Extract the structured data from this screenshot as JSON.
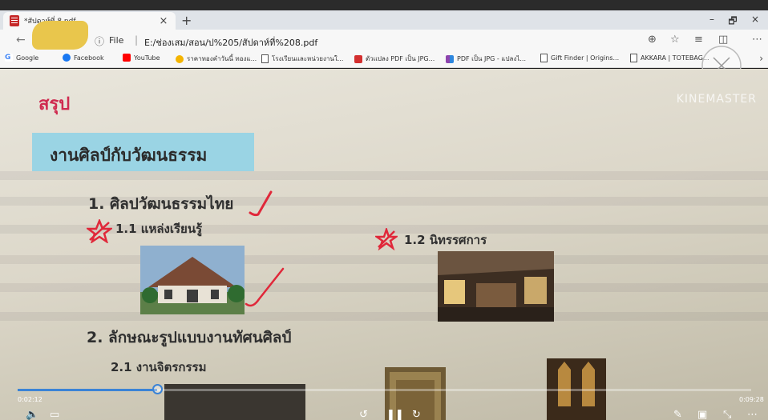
{
  "browser": {
    "tab_title": "*สัปดาห์ที่ 8.pdf",
    "tab_close": "×",
    "new_tab": "+",
    "minimize": "–",
    "restore": "🗗",
    "close": "×",
    "address": {
      "info_icon": "ⓘ",
      "scheme_label": "File",
      "separator": "|",
      "url": "E:/ช่องเสม/สอน/ป%205/สัปดาห์ที่%208.pdf"
    },
    "icons": [
      "back-arrow-icon",
      "forward-arrow-icon",
      "refresh-icon",
      "zoom-icon",
      "favorite-star-icon",
      "favorites-list-icon",
      "collections-icon",
      "profile-icon",
      "more-icon"
    ]
  },
  "bookmarks": [
    {
      "label": "Google",
      "color": "#4285f4"
    },
    {
      "label": "Facebook",
      "color": "#1877f2"
    },
    {
      "label": "YouTube",
      "color": "#ff0000"
    },
    {
      "label": "ราคาทองคำวันนี้ ทองแ...",
      "color": "#f4b400"
    },
    {
      "label": "โรงเรียนและหน่วยงานใ...",
      "color": ""
    },
    {
      "label": "ตัวแปลง PDF เป็น JPG...",
      "color": "#d32f2f"
    },
    {
      "label": "PDF เป็น JPG - แปลงไ...",
      "color": "#8e44ad"
    },
    {
      "label": "Gift Finder | Origins...",
      "color": ""
    },
    {
      "label": "AKKARA | TOTEBAG...",
      "color": ""
    }
  ],
  "bookmarks_more": "›",
  "page": {
    "summary_label": "สรุป",
    "title": "งานศิลป์กับวัฒนธรรม",
    "section1": "1. ศิลปวัฒนธรรมไทย",
    "section1_1": "1.1 แหล่งเรียนรู้",
    "section1_2": "1.2 นิทรรศการ",
    "section2": "2. ลักษณะรูปแบบงานทัศนศิลป์",
    "section2_1": "2.1 งานจิตรกรรม",
    "watermark": "KINEMASTER",
    "annotation_color": "#e0283a"
  },
  "video": {
    "current_time": "0:02:12",
    "total_time": "0:09:28",
    "progress": 0.19,
    "accent": "#3b83d6"
  }
}
